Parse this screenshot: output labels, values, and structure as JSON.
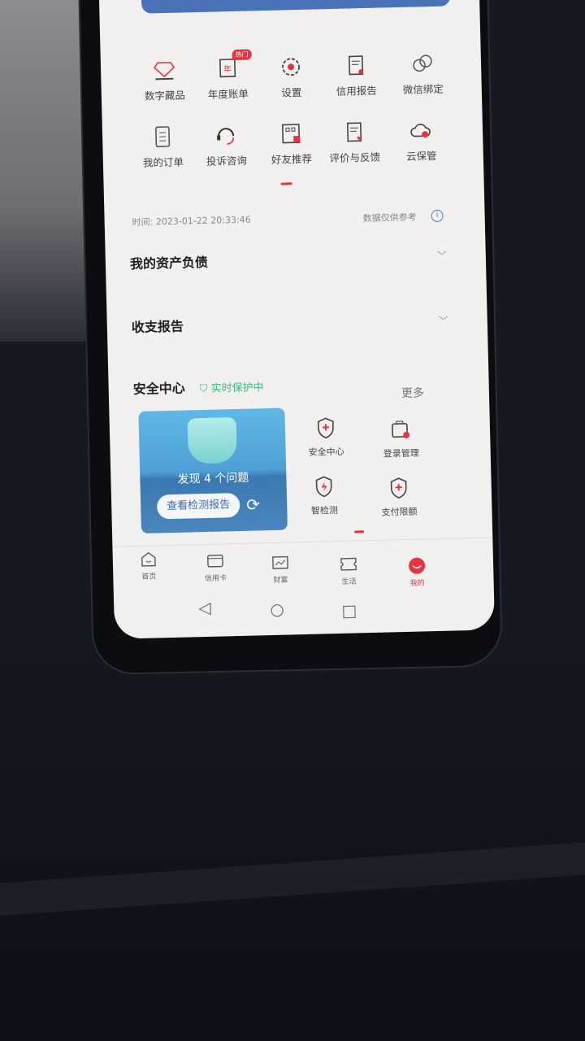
{
  "shortcuts_row1": [
    {
      "label": "数字藏品",
      "icon": "diamond-icon"
    },
    {
      "label": "年度账单",
      "icon": "annual-bill-icon",
      "badge": "热门"
    },
    {
      "label": "设置",
      "icon": "gear-icon"
    },
    {
      "label": "信用报告",
      "icon": "credit-report-icon"
    },
    {
      "label": "微信绑定",
      "icon": "chat-bubbles-icon"
    }
  ],
  "shortcuts_row2": [
    {
      "label": "我的订单",
      "icon": "order-list-icon"
    },
    {
      "label": "投诉咨询",
      "icon": "headset-icon"
    },
    {
      "label": "好友推荐",
      "icon": "qr-thumbs-up-icon"
    },
    {
      "label": "评价与反馈",
      "icon": "feedback-icon"
    },
    {
      "label": "云保管",
      "icon": "cloud-icon"
    }
  ],
  "info": {
    "timestamp": "时间: 2023-01-22 20:33:46",
    "disclaimer": "数据仅供参考"
  },
  "sections": {
    "assets": "我的资产负债",
    "income": "收支报告"
  },
  "security": {
    "title": "安全中心",
    "status": "实时保护中",
    "more": "更多",
    "card": {
      "issues": "发现 4 个问题",
      "report_button": "查看检测报告"
    },
    "items": [
      {
        "label": "安全中心"
      },
      {
        "label": "登录管理"
      },
      {
        "label": "智检测"
      },
      {
        "label": "支付限额"
      }
    ]
  },
  "tabs": [
    {
      "label": "首页"
    },
    {
      "label": "信用卡"
    },
    {
      "label": "财富"
    },
    {
      "label": "生活"
    },
    {
      "label": "我的",
      "active": true
    }
  ],
  "colors": {
    "accent": "#e5343f",
    "banner": "#4a72b8",
    "safe": "#3dbb7a"
  }
}
